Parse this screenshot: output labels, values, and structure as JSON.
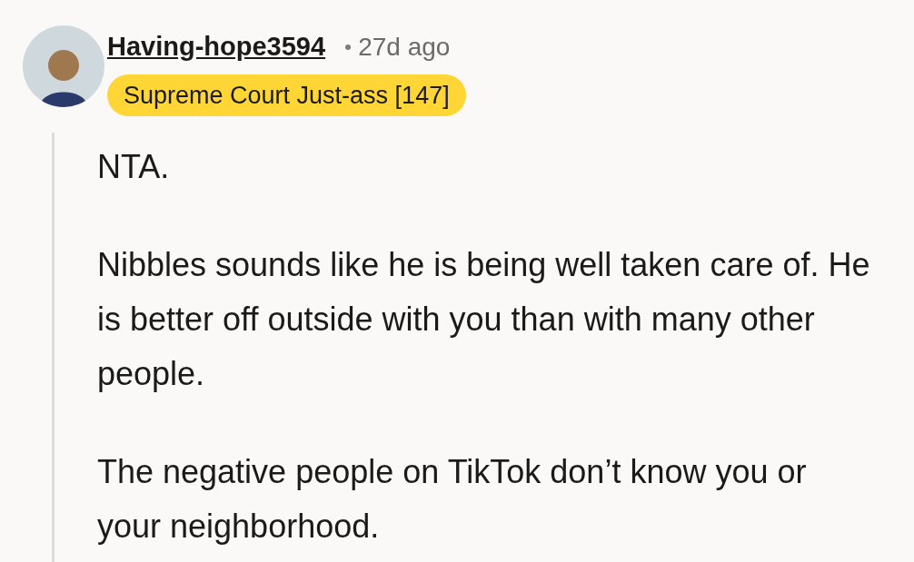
{
  "comment": {
    "author": "Having-hope3594",
    "age": "27d ago",
    "flair": "Supreme Court Just-ass [147]",
    "paragraphs": [
      "NTA.",
      "Nibbles sounds like he is being well taken care of. He is better off outside with you than with many other people.",
      "The negative people on TikTok don’t know you or your neighborhood."
    ]
  }
}
